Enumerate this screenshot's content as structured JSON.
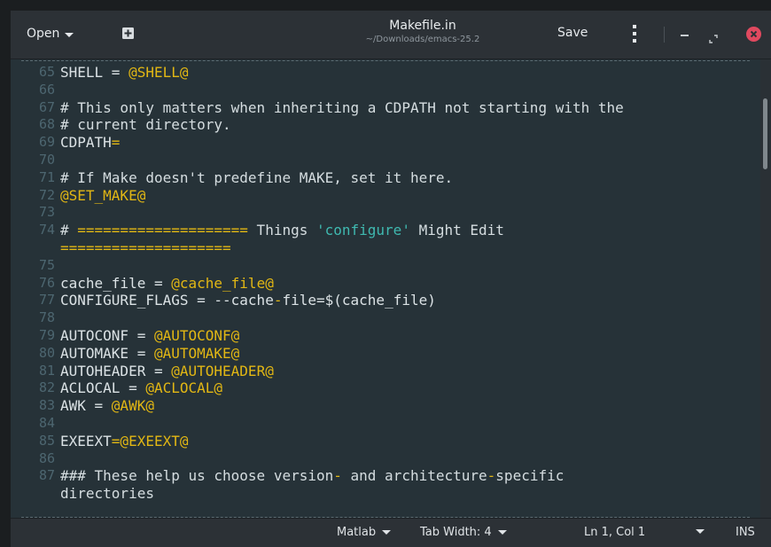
{
  "header": {
    "open_label": "Open",
    "title": "Makefile.in",
    "subtitle": "~/Downloads/emacs-25.2",
    "save_label": "Save"
  },
  "editor": {
    "lines": [
      {
        "n": "65",
        "parts": [
          [
            "SHELL = ",
            "fg"
          ],
          [
            "@SHELL@",
            "var"
          ]
        ]
      },
      {
        "n": "66",
        "parts": []
      },
      {
        "n": "67",
        "parts": [
          [
            "# This only matters when inheriting a CDPATH not starting with the",
            "comment"
          ]
        ]
      },
      {
        "n": "68",
        "parts": [
          [
            "# current directory.",
            "comment"
          ]
        ]
      },
      {
        "n": "69",
        "parts": [
          [
            "CDPATH",
            "fg"
          ],
          [
            "=",
            "op"
          ]
        ]
      },
      {
        "n": "70",
        "parts": []
      },
      {
        "n": "71",
        "parts": [
          [
            "# If Make doesn't predefine MAKE, set it here.",
            "comment"
          ]
        ]
      },
      {
        "n": "72",
        "parts": [
          [
            "@SET_MAKE@",
            "var"
          ]
        ]
      },
      {
        "n": "73",
        "parts": []
      },
      {
        "n": "74",
        "parts": [
          [
            "# ",
            "comment"
          ],
          [
            "====================",
            "var"
          ],
          [
            " Things ",
            "comment"
          ],
          [
            "'configure'",
            "str"
          ],
          [
            " Might Edit",
            "comment"
          ]
        ]
      },
      {
        "n": "",
        "parts": [
          [
            "====================",
            "var"
          ]
        ]
      },
      {
        "n": "75",
        "parts": []
      },
      {
        "n": "76",
        "parts": [
          [
            "cache_file = ",
            "fg"
          ],
          [
            "@cache_file@",
            "var"
          ]
        ]
      },
      {
        "n": "77",
        "parts": [
          [
            "CONFIGURE_FLAGS = --cache",
            "fg"
          ],
          [
            "-",
            "op"
          ],
          [
            "file=$(cache_file)",
            "fg"
          ]
        ]
      },
      {
        "n": "78",
        "parts": []
      },
      {
        "n": "79",
        "parts": [
          [
            "AUTOCONF = ",
            "fg"
          ],
          [
            "@AUTOCONF@",
            "var"
          ]
        ]
      },
      {
        "n": "80",
        "parts": [
          [
            "AUTOMAKE = ",
            "fg"
          ],
          [
            "@AUTOMAKE@",
            "var"
          ]
        ]
      },
      {
        "n": "81",
        "parts": [
          [
            "AUTOHEADER = ",
            "fg"
          ],
          [
            "@AUTOHEADER@",
            "var"
          ]
        ]
      },
      {
        "n": "82",
        "parts": [
          [
            "ACLOCAL = ",
            "fg"
          ],
          [
            "@ACLOCAL@",
            "var"
          ]
        ]
      },
      {
        "n": "83",
        "parts": [
          [
            "AWK = ",
            "fg"
          ],
          [
            "@AWK@",
            "var"
          ]
        ]
      },
      {
        "n": "84",
        "parts": []
      },
      {
        "n": "85",
        "parts": [
          [
            "EXEEXT",
            "fg"
          ],
          [
            "=@EXEEXT@",
            "var"
          ]
        ]
      },
      {
        "n": "86",
        "parts": []
      },
      {
        "n": "87",
        "parts": [
          [
            "### These help us choose version",
            "comment"
          ],
          [
            "-",
            "op"
          ],
          [
            " and architecture",
            "comment"
          ],
          [
            "-",
            "op"
          ],
          [
            "specific",
            "comment"
          ]
        ]
      },
      {
        "n": "",
        "parts": [
          [
            "directories",
            "comment"
          ]
        ]
      }
    ]
  },
  "statusbar": {
    "language": "Matlab",
    "tab_width": "Tab Width: 4",
    "position": "Ln 1, Col 1",
    "mode": "INS"
  },
  "colors": {
    "editor_bg": "#263238",
    "keyword": "#e2b714",
    "string": "#3fb9b0",
    "close": "#e0495f"
  },
  "icons": [
    "new-document-icon",
    "menu-dots-icon",
    "minimize-icon",
    "maximize-icon",
    "close-icon"
  ]
}
